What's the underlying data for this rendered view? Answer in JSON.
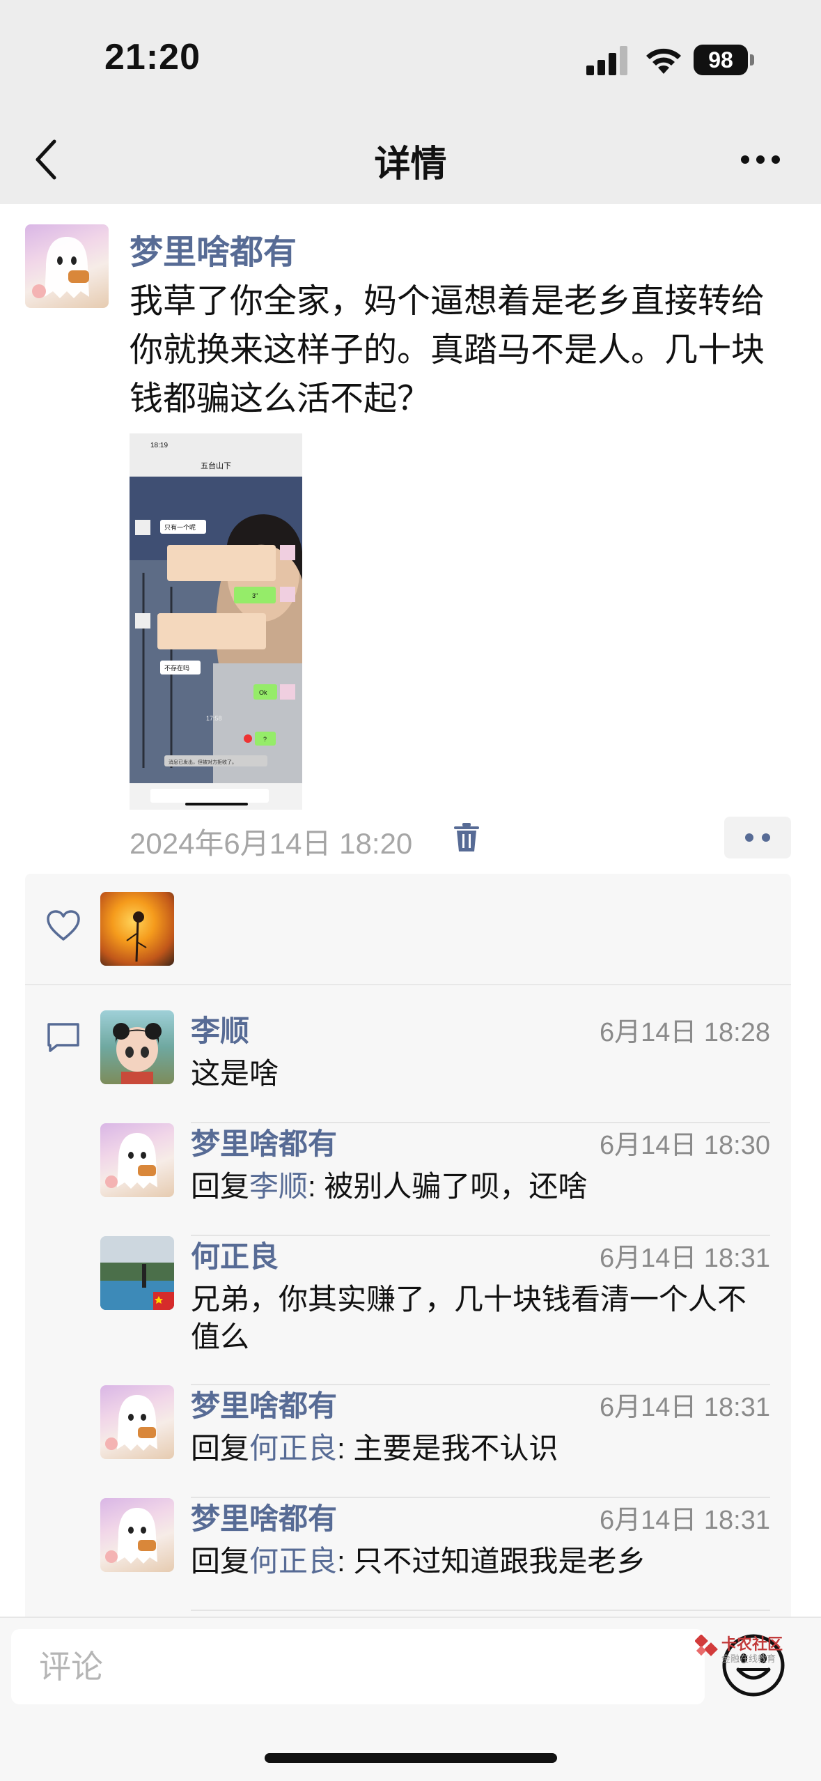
{
  "status_bar": {
    "time": "21:20",
    "battery": "98",
    "icons": [
      "signal-icon",
      "wifi-icon",
      "battery-icon"
    ]
  },
  "nav": {
    "title": "详情",
    "back_icon": "chevron-left-icon",
    "more_icon": "more-horizontal-icon"
  },
  "post": {
    "author": "梦里啥都有",
    "text": "我草了你全家，妈个逼想着是老乡直接转给你就换来这样子的。真踏马不是人。几十块钱都骗这么活不起？",
    "image": {
      "time": "18:19",
      "chat_title": "五台山下",
      "messages": [
        "只有一个呢",
        "3\"",
        "不存在吗",
        "Ok",
        "17:58",
        "?"
      ],
      "notice": "消息已发出，但被对方拒收了。"
    },
    "timestamp": "2024年6月14日 18:20"
  },
  "comments": [
    {
      "name": "李顺",
      "time": "6月14日 18:28",
      "prefix": "",
      "reply_to": "",
      "text": "这是啥"
    },
    {
      "name": "梦里啥都有",
      "time": "6月14日 18:30",
      "prefix": "回复",
      "reply_to": "李顺",
      "text": ": 被别人骗了呗，还啥"
    },
    {
      "name": "何正良",
      "time": "6月14日 18:31",
      "prefix": "",
      "reply_to": "",
      "text": "兄弟，你其实赚了，几十块钱看清一个人不值么"
    },
    {
      "name": "梦里啥都有",
      "time": "6月14日 18:31",
      "prefix": "回复",
      "reply_to": "何正良",
      "text": ": 主要是我不认识"
    },
    {
      "name": "梦里啥都有",
      "time": "6月14日 18:31",
      "prefix": "回复",
      "reply_to": "何正良",
      "text": ": 只不过知道跟我是老乡"
    }
  ],
  "input": {
    "placeholder": "评论"
  },
  "watermark": {
    "name": "卡农社区",
    "sub": "金融在线教育"
  },
  "colors": {
    "link": "#576b95",
    "bar_bg": "#ededed",
    "panel_bg": "#f7f7f7"
  }
}
